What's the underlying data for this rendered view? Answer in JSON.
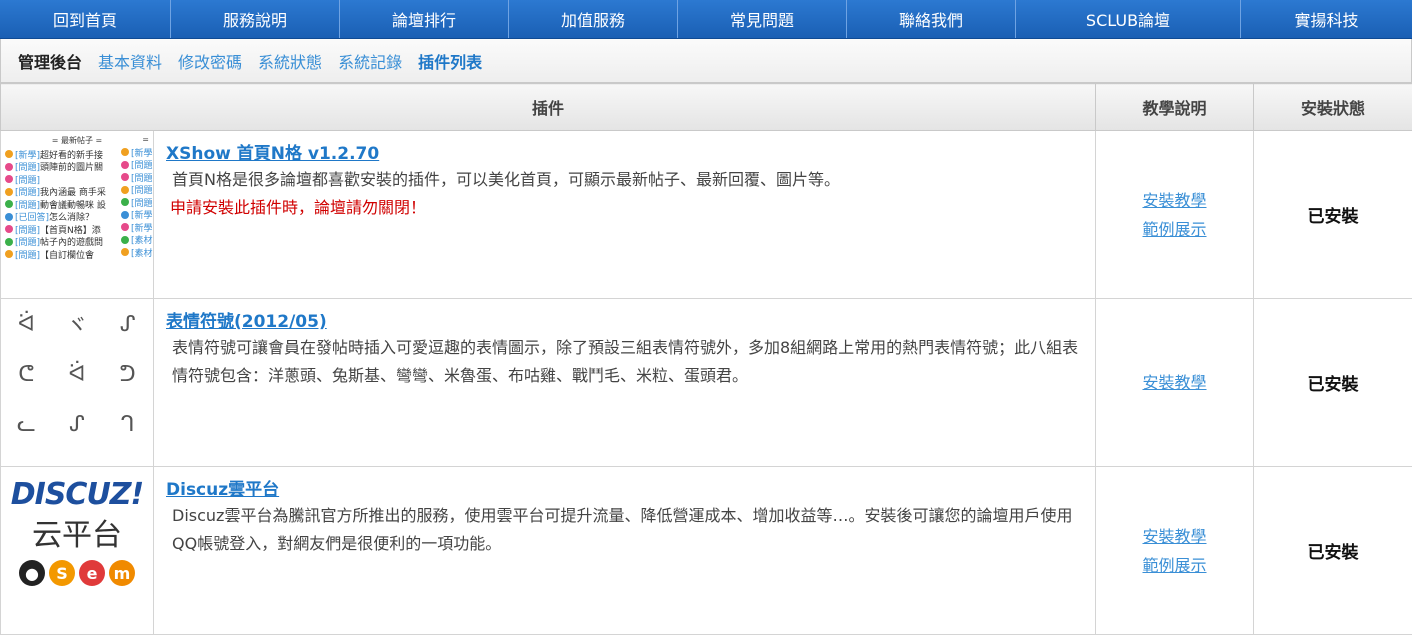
{
  "nav": [
    {
      "label": "回到首頁"
    },
    {
      "label": "服務說明"
    },
    {
      "label": "論壇排行"
    },
    {
      "label": "加值服務"
    },
    {
      "label": "常見問題"
    },
    {
      "label": "聯絡我們"
    },
    {
      "label": "SCLUB論壇"
    },
    {
      "label": "實揚科技"
    }
  ],
  "subnav": {
    "current": "管理後台",
    "links": [
      "基本資料",
      "修改密碼",
      "系統狀態",
      "系統記錄",
      "插件列表"
    ]
  },
  "table": {
    "headers": [
      "插件",
      "教學說明",
      "安裝狀態"
    ],
    "rows": [
      {
        "title": "XShow 首頁N格 v1.2.70",
        "desc": "首頁N格是很多論壇都喜歡安裝的插件，可以美化首頁，可顯示最新帖子、最新回覆、圖片等。",
        "warn": "申請安裝此插件時，論壇請勿關閉！",
        "link1": "安裝教學",
        "link2": "範例展示",
        "status": "已安裝",
        "thumb": {
          "head": "= 最新帖子 =",
          "head2": "=",
          "items": [
            {
              "tag": "[新學]",
              "text": "超好看的新手接"
            },
            {
              "tag": "[問題]",
              "text": "頭陣前的圖片關"
            },
            {
              "tag": "[問題]",
              "text": ""
            },
            {
              "tag": "[問題]",
              "text": "我內涵最 商手采"
            },
            {
              "tag": "[問題]",
              "text": "動會議動暢咪 設"
            },
            {
              "tag": "[已回答]",
              "text": "怎么消除？"
            },
            {
              "tag": "[問題]",
              "text": "【首頁N格】添"
            },
            {
              "tag": "[問題]",
              "text": "帖子內的遊戲問"
            },
            {
              "tag": "[問題]",
              "text": "【自訂欄位會"
            }
          ],
          "col2": [
            "[新學",
            "[問題",
            "[問題",
            "[問題",
            "[問題",
            "[新學",
            "[新學",
            "[素材",
            "[素材"
          ]
        }
      },
      {
        "title": "表情符號(2012/05)",
        "desc": "表情符號可讓會員在發帖時插入可愛逗趣的表情圖示，除了預設三組表情符號外，多加8組網路上常用的熱門表情符號；此八組表情符號包含：洋蔥頭、兔斯基、彎彎、米魯蛋、布咕雞、戰鬥毛、米粒、蛋頭君。",
        "link1": "安裝教學",
        "status": "已安裝"
      },
      {
        "title": "Discuz雲平台",
        "desc": "Discuz雲平台為騰訊官方所推出的服務，使用雲平台可提升流量、降低營運成本、增加收益等…。安裝後可讓您的論壇用戶使用QQ帳號登入，對網友們是很便利的一項功能。",
        "link1": "安裝教學",
        "link2": "範例展示",
        "status": "已安裝",
        "thumb": {
          "brand": "DISCUZ!",
          "sub": "云平台"
        }
      }
    ]
  }
}
